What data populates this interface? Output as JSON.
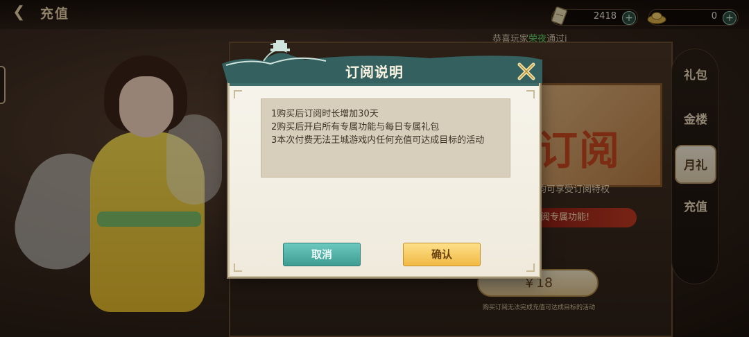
{
  "topbar": {
    "back_icon": "back-arrow-icon",
    "title": "充值",
    "currency": [
      {
        "icon": "ticket-icon",
        "value": "2418",
        "add_icon": "plus-icon"
      },
      {
        "icon": "gold-ingot-icon",
        "value": "0",
        "add_icon": "plus-icon"
      }
    ]
  },
  "marquee": {
    "prefix": "恭喜玩家",
    "player": "荣夜",
    "suffix": "通过i"
  },
  "side_tabs": [
    {
      "label": "礼包",
      "active": false
    },
    {
      "label": "金楼",
      "active": false
    },
    {
      "label": "月礼",
      "active": true
    },
    {
      "label": "充值",
      "active": false
    }
  ],
  "background_panel": {
    "banner_text": "订阅",
    "subtitle": "均可享受订阅特权",
    "red_pill": "阅专属功能!",
    "price": "￥18",
    "price_note": "购买订阅无法完成充值可达成目标的活动"
  },
  "modal": {
    "title": "订阅说明",
    "close_icon": "close-x-icon",
    "lines": [
      "1购买后订阅时长增加30天",
      "2购买后开启所有专属功能与每日专属礼包",
      "3本次付费无法王城游戏内任何充值可达成目标的活动"
    ],
    "cancel_label": "取消",
    "confirm_label": "确认"
  },
  "colors": {
    "header_teal": "#3e6f6c",
    "cancel_teal": "#4fb1a8",
    "confirm_gold": "#f4c552",
    "highlight_green": "#5fd36a"
  }
}
